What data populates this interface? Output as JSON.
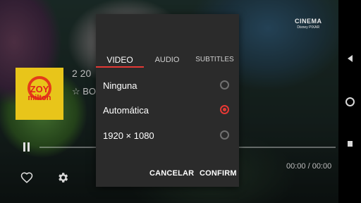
{
  "background": {
    "channel_logo": {
      "title": "CINEMA",
      "subtitle": "Disney PIXAR"
    },
    "video": {
      "meta_line1": "2 20",
      "meta_line2": "☆ BO",
      "thumbnail": {
        "top_text": "ZOY",
        "bottom_text": "milton"
      }
    },
    "playback": {
      "time": "00:00 / 00:00",
      "progress": 0
    }
  },
  "dialog": {
    "tabs": [
      {
        "label": "VIDEO",
        "selected": true
      },
      {
        "label": "AUDIO",
        "selected": false
      },
      {
        "label": "SUBTITLES",
        "selected": false
      }
    ],
    "options": [
      {
        "label": "Ninguna",
        "selected": false
      },
      {
        "label": "Automática",
        "selected": true
      },
      {
        "label": "1920 × 1080",
        "selected": false
      }
    ],
    "cancel_label": "CANCELAR",
    "confirm_label": "CONFIRM",
    "accent_color": "#e53935"
  },
  "icons": {
    "pause": "pause-icon",
    "favorite": "heart-icon",
    "settings": "gear-icon",
    "nav_back": "back-triangle-icon",
    "nav_home": "home-circle-icon",
    "nav_recent": "recent-square-icon"
  }
}
